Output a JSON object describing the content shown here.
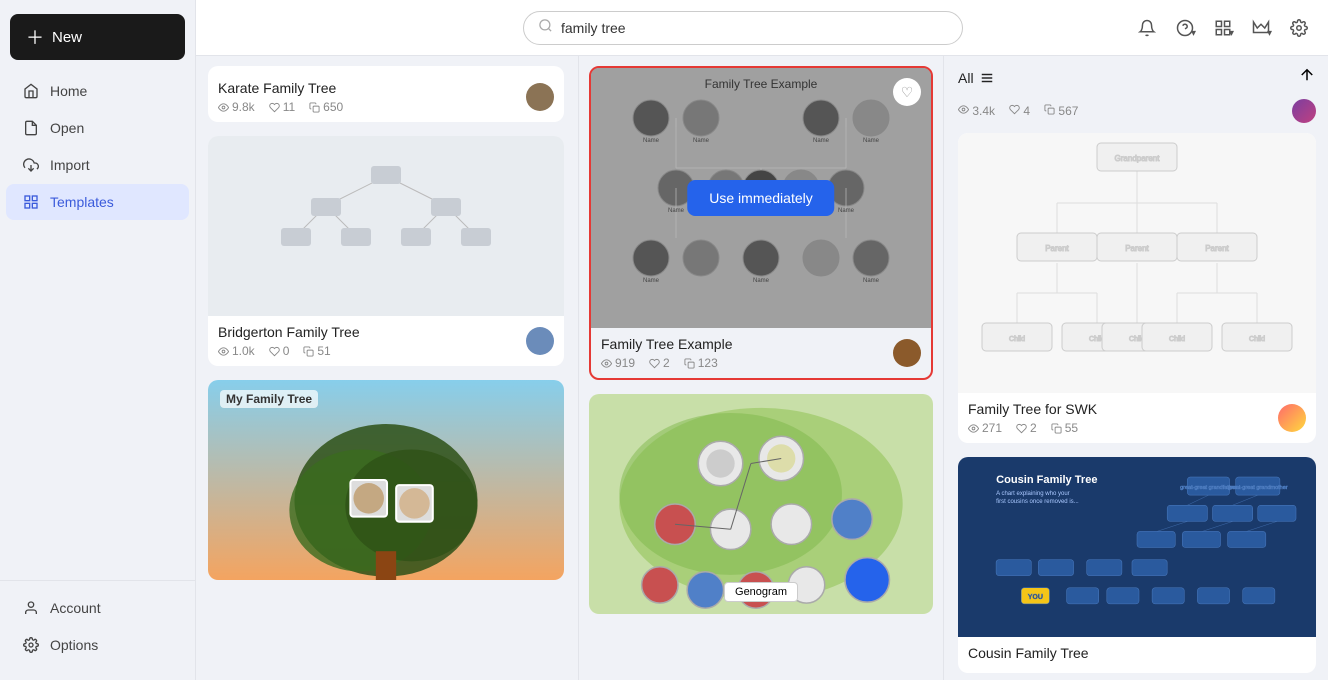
{
  "sidebar": {
    "new_button_label": "New",
    "items": [
      {
        "id": "home",
        "label": "Home",
        "icon": "home-icon",
        "active": false
      },
      {
        "id": "open",
        "label": "Open",
        "icon": "file-icon",
        "active": false
      },
      {
        "id": "import",
        "label": "Import",
        "icon": "import-icon",
        "active": false
      },
      {
        "id": "templates",
        "label": "Templates",
        "icon": "templates-icon",
        "active": true
      }
    ],
    "bottom_items": [
      {
        "id": "account",
        "label": "Account",
        "icon": "account-icon"
      },
      {
        "id": "options",
        "label": "Options",
        "icon": "gear-icon"
      }
    ]
  },
  "header": {
    "search_placeholder": "family tree",
    "search_value": "family tree"
  },
  "filter": {
    "label": "All",
    "stats": {
      "views": "3.4k",
      "likes": "4",
      "copies": "567"
    }
  },
  "left_column": {
    "top_card": {
      "title": "Karate Family Tree",
      "views": "9.8k",
      "likes": "11",
      "copies": "650"
    },
    "cards": [
      {
        "title": "Bridgerton Family Tree",
        "views": "1.0k",
        "likes": "0",
        "copies": "51",
        "bg": "#e8eaf0"
      },
      {
        "title": "My Family Tree",
        "views": "",
        "likes": "",
        "copies": "",
        "bg": "#87ceeb",
        "has_photo": true
      }
    ]
  },
  "mid_column": {
    "featured_card": {
      "title": "Family Tree Example",
      "views": "919",
      "likes": "2",
      "copies": "123",
      "use_immediately_label": "Use immediately",
      "bg": "#9e9e9e"
    },
    "bottom_card": {
      "title": "Genogram",
      "bg": "#d4e8c2"
    }
  },
  "right_column": {
    "top_card": {
      "title": "Family Tree for SWK",
      "views": "271",
      "likes": "2",
      "copies": "55",
      "bg": "#f5f5f5"
    },
    "bottom_card": {
      "title": "Cousin Family Tree",
      "bg": "#1a3a6b"
    }
  }
}
